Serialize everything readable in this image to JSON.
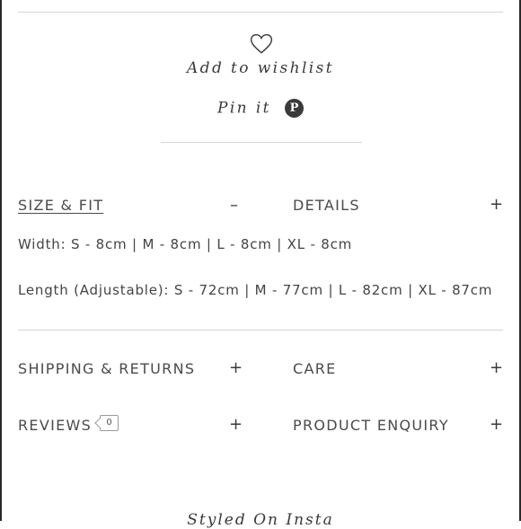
{
  "wishlist": {
    "label": "Add to wishlist",
    "icon": "heart-icon"
  },
  "pin": {
    "label": "Pin it",
    "icon": "pinterest-icon",
    "icon_glyph": "P"
  },
  "sections": {
    "size_fit": {
      "label": "SIZE & FIT",
      "toggle": "–"
    },
    "details": {
      "label": "DETAILS",
      "toggle": "+"
    },
    "shipping": {
      "label": "SHIPPING & RETURNS",
      "toggle": "+"
    },
    "care": {
      "label": "CARE",
      "toggle": "+"
    },
    "reviews": {
      "label": "REVIEWS",
      "count": "0",
      "toggle": "+"
    },
    "enquiry": {
      "label": "PRODUCT ENQUIRY",
      "toggle": "+"
    }
  },
  "size_fit_content": {
    "width": "Width: S - 8cm | M - 8cm | L - 8cm | XL - 8cm",
    "length": "Length (Adjustable): S - 72cm | M - 77cm | L - 82cm | XL - 87cm"
  },
  "styled_heading": "Styled On Insta"
}
